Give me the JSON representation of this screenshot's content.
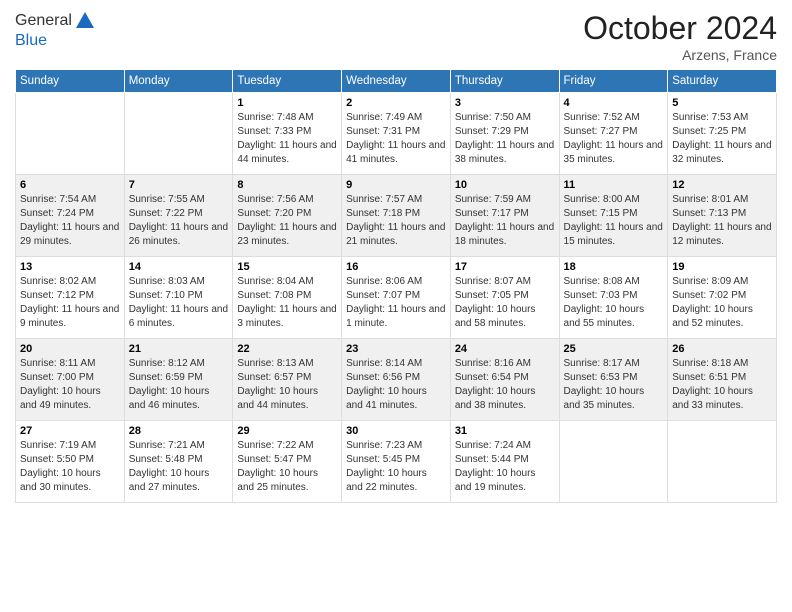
{
  "logo": {
    "line1": "General",
    "line2": "Blue"
  },
  "header": {
    "month": "October 2024",
    "location": "Arzens, France"
  },
  "weekdays": [
    "Sunday",
    "Monday",
    "Tuesday",
    "Wednesday",
    "Thursday",
    "Friday",
    "Saturday"
  ],
  "weeks": [
    [
      {
        "day": null,
        "info": null
      },
      {
        "day": null,
        "info": null
      },
      {
        "day": "1",
        "sunrise": "7:48 AM",
        "sunset": "7:33 PM",
        "daylight": "11 hours and 44 minutes."
      },
      {
        "day": "2",
        "sunrise": "7:49 AM",
        "sunset": "7:31 PM",
        "daylight": "11 hours and 41 minutes."
      },
      {
        "day": "3",
        "sunrise": "7:50 AM",
        "sunset": "7:29 PM",
        "daylight": "11 hours and 38 minutes."
      },
      {
        "day": "4",
        "sunrise": "7:52 AM",
        "sunset": "7:27 PM",
        "daylight": "11 hours and 35 minutes."
      },
      {
        "day": "5",
        "sunrise": "7:53 AM",
        "sunset": "7:25 PM",
        "daylight": "11 hours and 32 minutes."
      }
    ],
    [
      {
        "day": "6",
        "sunrise": "7:54 AM",
        "sunset": "7:24 PM",
        "daylight": "11 hours and 29 minutes."
      },
      {
        "day": "7",
        "sunrise": "7:55 AM",
        "sunset": "7:22 PM",
        "daylight": "11 hours and 26 minutes."
      },
      {
        "day": "8",
        "sunrise": "7:56 AM",
        "sunset": "7:20 PM",
        "daylight": "11 hours and 23 minutes."
      },
      {
        "day": "9",
        "sunrise": "7:57 AM",
        "sunset": "7:18 PM",
        "daylight": "11 hours and 21 minutes."
      },
      {
        "day": "10",
        "sunrise": "7:59 AM",
        "sunset": "7:17 PM",
        "daylight": "11 hours and 18 minutes."
      },
      {
        "day": "11",
        "sunrise": "8:00 AM",
        "sunset": "7:15 PM",
        "daylight": "11 hours and 15 minutes."
      },
      {
        "day": "12",
        "sunrise": "8:01 AM",
        "sunset": "7:13 PM",
        "daylight": "11 hours and 12 minutes."
      }
    ],
    [
      {
        "day": "13",
        "sunrise": "8:02 AM",
        "sunset": "7:12 PM",
        "daylight": "11 hours and 9 minutes."
      },
      {
        "day": "14",
        "sunrise": "8:03 AM",
        "sunset": "7:10 PM",
        "daylight": "11 hours and 6 minutes."
      },
      {
        "day": "15",
        "sunrise": "8:04 AM",
        "sunset": "7:08 PM",
        "daylight": "11 hours and 3 minutes."
      },
      {
        "day": "16",
        "sunrise": "8:06 AM",
        "sunset": "7:07 PM",
        "daylight": "11 hours and 1 minute."
      },
      {
        "day": "17",
        "sunrise": "8:07 AM",
        "sunset": "7:05 PM",
        "daylight": "10 hours and 58 minutes."
      },
      {
        "day": "18",
        "sunrise": "8:08 AM",
        "sunset": "7:03 PM",
        "daylight": "10 hours and 55 minutes."
      },
      {
        "day": "19",
        "sunrise": "8:09 AM",
        "sunset": "7:02 PM",
        "daylight": "10 hours and 52 minutes."
      }
    ],
    [
      {
        "day": "20",
        "sunrise": "8:11 AM",
        "sunset": "7:00 PM",
        "daylight": "10 hours and 49 minutes."
      },
      {
        "day": "21",
        "sunrise": "8:12 AM",
        "sunset": "6:59 PM",
        "daylight": "10 hours and 46 minutes."
      },
      {
        "day": "22",
        "sunrise": "8:13 AM",
        "sunset": "6:57 PM",
        "daylight": "10 hours and 44 minutes."
      },
      {
        "day": "23",
        "sunrise": "8:14 AM",
        "sunset": "6:56 PM",
        "daylight": "10 hours and 41 minutes."
      },
      {
        "day": "24",
        "sunrise": "8:16 AM",
        "sunset": "6:54 PM",
        "daylight": "10 hours and 38 minutes."
      },
      {
        "day": "25",
        "sunrise": "8:17 AM",
        "sunset": "6:53 PM",
        "daylight": "10 hours and 35 minutes."
      },
      {
        "day": "26",
        "sunrise": "8:18 AM",
        "sunset": "6:51 PM",
        "daylight": "10 hours and 33 minutes."
      }
    ],
    [
      {
        "day": "27",
        "sunrise": "7:19 AM",
        "sunset": "5:50 PM",
        "daylight": "10 hours and 30 minutes."
      },
      {
        "day": "28",
        "sunrise": "7:21 AM",
        "sunset": "5:48 PM",
        "daylight": "10 hours and 27 minutes."
      },
      {
        "day": "29",
        "sunrise": "7:22 AM",
        "sunset": "5:47 PM",
        "daylight": "10 hours and 25 minutes."
      },
      {
        "day": "30",
        "sunrise": "7:23 AM",
        "sunset": "5:45 PM",
        "daylight": "10 hours and 22 minutes."
      },
      {
        "day": "31",
        "sunrise": "7:24 AM",
        "sunset": "5:44 PM",
        "daylight": "10 hours and 19 minutes."
      },
      {
        "day": null,
        "info": null
      },
      {
        "day": null,
        "info": null
      }
    ]
  ],
  "labels": {
    "sunrise": "Sunrise:",
    "sunset": "Sunset:",
    "daylight": "Daylight:"
  }
}
